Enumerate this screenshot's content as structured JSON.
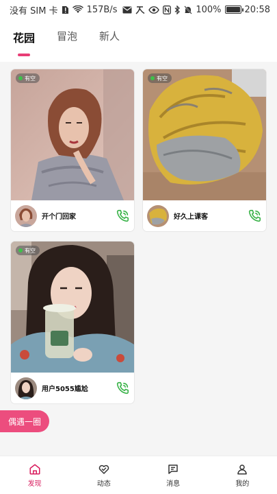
{
  "statusbar": {
    "carrier": "没有 SIM 卡",
    "speed": "157B/s",
    "battery_text": "100%",
    "battery_level": 1.0,
    "time": "20:58"
  },
  "tabs": [
    {
      "label": "花园",
      "active": true
    },
    {
      "label": "冒泡",
      "active": false
    },
    {
      "label": "新人",
      "active": false
    }
  ],
  "cards": [
    {
      "status": "有空",
      "name": "开个门回家"
    },
    {
      "status": "有空",
      "name": "好久上课客"
    },
    {
      "status": "有空",
      "name": "用户5055尴尬"
    }
  ],
  "meet_button": "偶遇一圈",
  "nav": [
    {
      "label": "发现",
      "icon": "home-icon",
      "active": true
    },
    {
      "label": "动态",
      "icon": "heart-icon",
      "active": false
    },
    {
      "label": "消息",
      "icon": "message-icon",
      "active": false
    },
    {
      "label": "我的",
      "icon": "user-icon",
      "active": false
    }
  ],
  "colors": {
    "accent": "#e83e76",
    "online": "#3ec14a",
    "call": "#3bb34a"
  }
}
